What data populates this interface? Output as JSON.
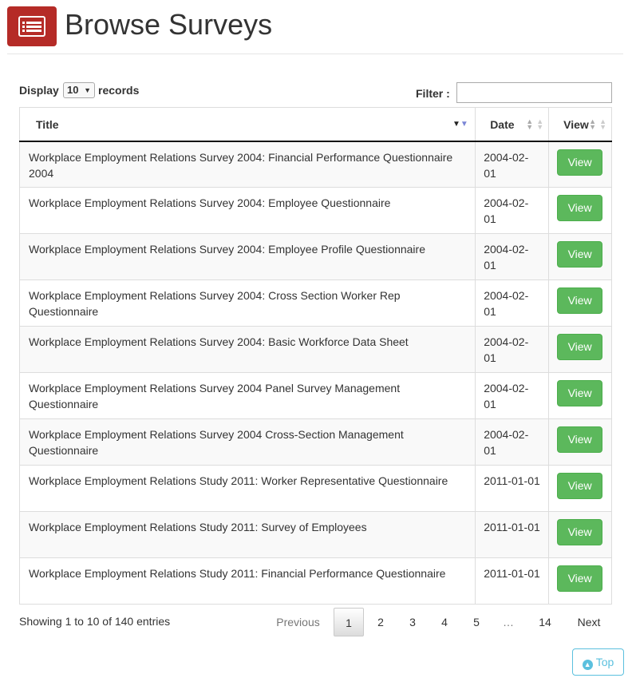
{
  "header": {
    "title": "Browse Surveys",
    "logo_icon": "list-icon",
    "brand_color": "#b52b27"
  },
  "controls": {
    "display_label": "Display",
    "records_value": "10",
    "records_label": "records",
    "filter_label": "Filter :",
    "filter_value": ""
  },
  "table": {
    "columns": [
      "Title",
      "Date",
      "View"
    ],
    "rows": [
      {
        "title": "Workplace Employment Relations Survey 2004: Financial Performance Questionnaire 2004",
        "date": "2004-02-01",
        "action": "View"
      },
      {
        "title": "Workplace Employment Relations Survey 2004: Employee Questionnaire",
        "date": "2004-02-01",
        "action": "View"
      },
      {
        "title": "Workplace Employment Relations Survey 2004: Employee Profile Questionnaire",
        "date": "2004-02-01",
        "action": "View"
      },
      {
        "title": "Workplace Employment Relations Survey 2004: Cross Section Worker Rep Questionnaire",
        "date": "2004-02-01",
        "action": "View"
      },
      {
        "title": "Workplace Employment Relations Survey 2004: Basic Workforce Data Sheet",
        "date": "2004-02-01",
        "action": "View"
      },
      {
        "title": "Workplace Employment Relations Survey 2004 Panel Survey Management Questionnaire",
        "date": "2004-02-01",
        "action": "View"
      },
      {
        "title": "Workplace Employment Relations Survey 2004 Cross-Section Management Questionnaire",
        "date": "2004-02-01",
        "action": "View"
      },
      {
        "title": "Workplace Employment Relations Study 2011: Worker Representative Questionnaire",
        "date": "2011-01-01",
        "action": "View"
      },
      {
        "title": "Workplace Employment Relations Study 2011: Survey of Employees",
        "date": "2011-01-01",
        "action": "View"
      },
      {
        "title": "Workplace Employment Relations Study 2011: Financial Performance Questionnaire",
        "date": "2011-01-01",
        "action": "View"
      }
    ],
    "sorted_column": "Title",
    "sort_direction": "descending"
  },
  "footer": {
    "info": "Showing 1 to 10 of 140 entries",
    "pagination": {
      "previous": "Previous",
      "pages": [
        "1",
        "2",
        "3",
        "4",
        "5"
      ],
      "current": "1",
      "ellipsis": "…",
      "last": "14",
      "next": "Next"
    },
    "top_button": "Top",
    "top_icon": "arrow-up-circle-icon"
  },
  "colors": {
    "view_button": "#5cb85c",
    "top_button": "#5bc0de"
  }
}
